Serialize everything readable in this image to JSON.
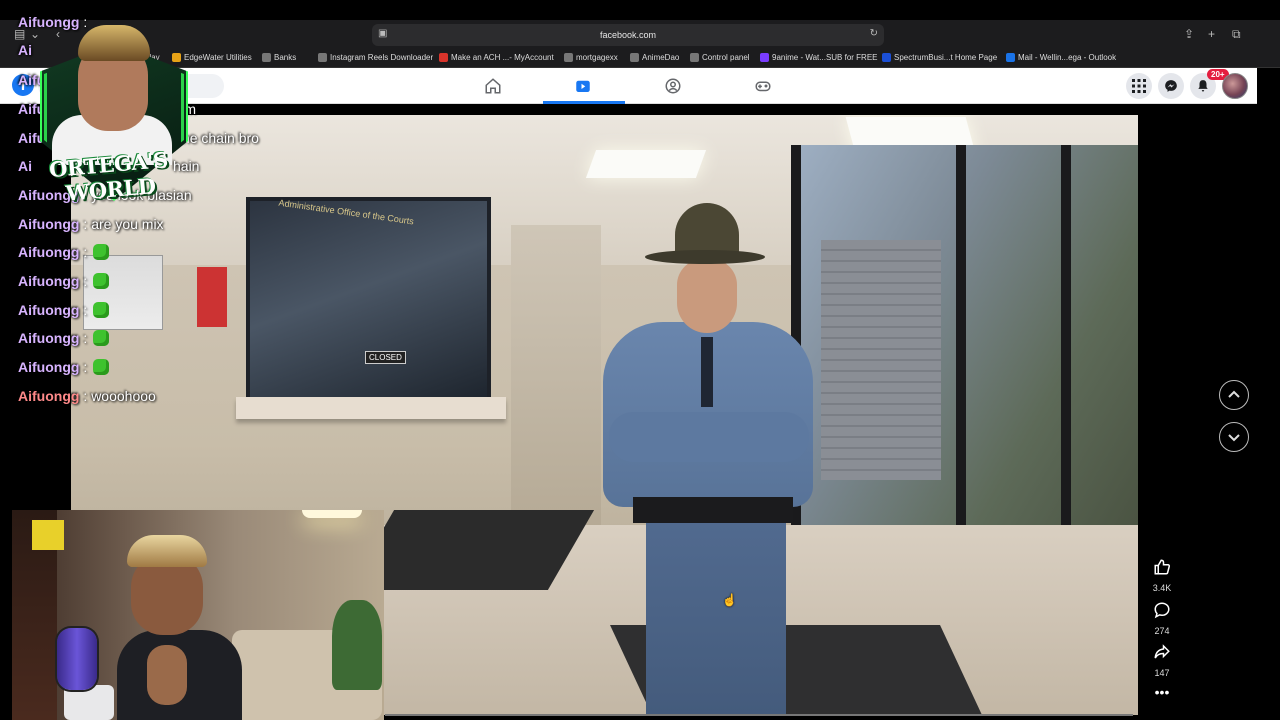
{
  "browser": {
    "url": "facebook.com",
    "bookmarks": [
      {
        "label": "Play",
        "color": "#444"
      },
      {
        "label": "EdgeWater Utilities",
        "color": "#e8a317"
      },
      {
        "label": "Banks",
        "color": "#777"
      },
      {
        "label": "Instagram Reels Downloader",
        "color": "#777"
      },
      {
        "label": "Make an ACH ...- MyAccount",
        "color": "#d9342b"
      },
      {
        "label": "mortgagexx",
        "color": "#777"
      },
      {
        "label": "AnimeDao",
        "color": "#777"
      },
      {
        "label": "Control panel",
        "color": "#777"
      },
      {
        "label": "9anime - Wat...SUB for FREE",
        "color": "#7a3cff"
      },
      {
        "label": "SpectrumBusi...t Home Page",
        "color": "#1b4fd6"
      },
      {
        "label": "Mail - Wellin...ega - Outlook",
        "color": "#1a73e8"
      }
    ]
  },
  "facebook": {
    "logo": "f",
    "notifications_badge": "20+",
    "nav_icons": [
      "home-icon",
      "video-icon",
      "groups-icon",
      "gaming-icon"
    ],
    "accent": "#1877f2"
  },
  "chat": [
    {
      "user": "Aifuongg",
      "msg": ": ",
      "emote": false
    },
    {
      "user": "Ai",
      "msg": "",
      "emote": false
    },
    {
      "user": "Aifu",
      "msg": "",
      "emote": false
    },
    {
      "user": "Aifu",
      "msg": "form",
      "emote": false
    },
    {
      "user": "Aifu",
      "msg": "u get the chain bro",
      "emote": false
    },
    {
      "user": "Ai",
      "msg": "hain",
      "emote": false
    },
    {
      "user": "Aifuongg",
      "msg": ": you look blasian",
      "emote": false
    },
    {
      "user": "Aifuongg",
      "msg": ": are you mix",
      "emote": false
    },
    {
      "user": "Aifuongg",
      "msg": ":",
      "emote": true
    },
    {
      "user": "Aifuongg",
      "msg": ":",
      "emote": true
    },
    {
      "user": "Aifuongg",
      "msg": ":",
      "emote": true
    },
    {
      "user": "Aifuongg",
      "msg": ":",
      "emote": true
    },
    {
      "user": "Aifuongg",
      "msg": ":",
      "emote": true
    },
    {
      "user": "Aifuongg",
      "msg": ": wooohooo",
      "emote": false,
      "alt": true
    }
  ],
  "overlay": {
    "logo_text": "ORTEGA'S WORLD"
  },
  "video": {
    "office_sign": "Administrative Office of the Courts",
    "closed_sign": "CLOSED"
  },
  "actions": {
    "likes": "3.4K",
    "comments": "274",
    "shares": "147"
  }
}
